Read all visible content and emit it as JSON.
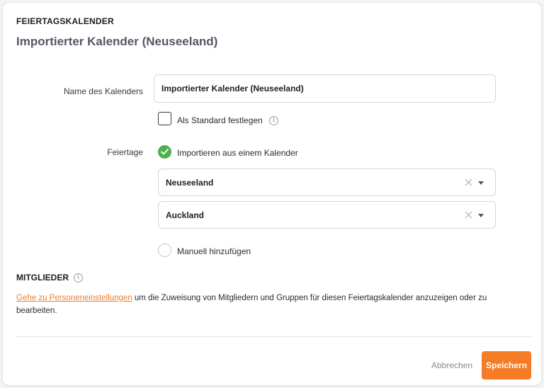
{
  "header": {
    "section_label": "FEIERTAGSKALENDER",
    "title": "Importierter Kalender (Neuseeland)"
  },
  "form": {
    "name_label": "Name des Kalenders",
    "name_value": "Importierter Kalender (Neuseeland)",
    "default_label": "Als Standard festlegen",
    "default_checked": false,
    "holidays_label": "Feiertage",
    "import_option_label": "Importieren aus einem Kalender",
    "import_option_selected": true,
    "country_value": "Neuseeland",
    "region_value": "Auckland",
    "manual_option_label": "Manuell hinzufügen",
    "manual_option_selected": false
  },
  "members": {
    "label": "MITGLIEDER",
    "link_text": "Gehe zu Personeneinstellungen",
    "description": " um die Zuweisung von Mitgliedern und Gruppen für diesen Feiertagskalender anzuzeigen oder zu bearbeiten."
  },
  "footer": {
    "cancel_label": "Abbrechen",
    "save_label": "Speichern"
  },
  "colors": {
    "accent": "#f57c25",
    "success": "#4caf50",
    "title": "#545666"
  },
  "icons": {
    "info": "info-icon",
    "check": "check-icon",
    "clear": "clear-icon",
    "caret": "chevron-down-icon"
  }
}
